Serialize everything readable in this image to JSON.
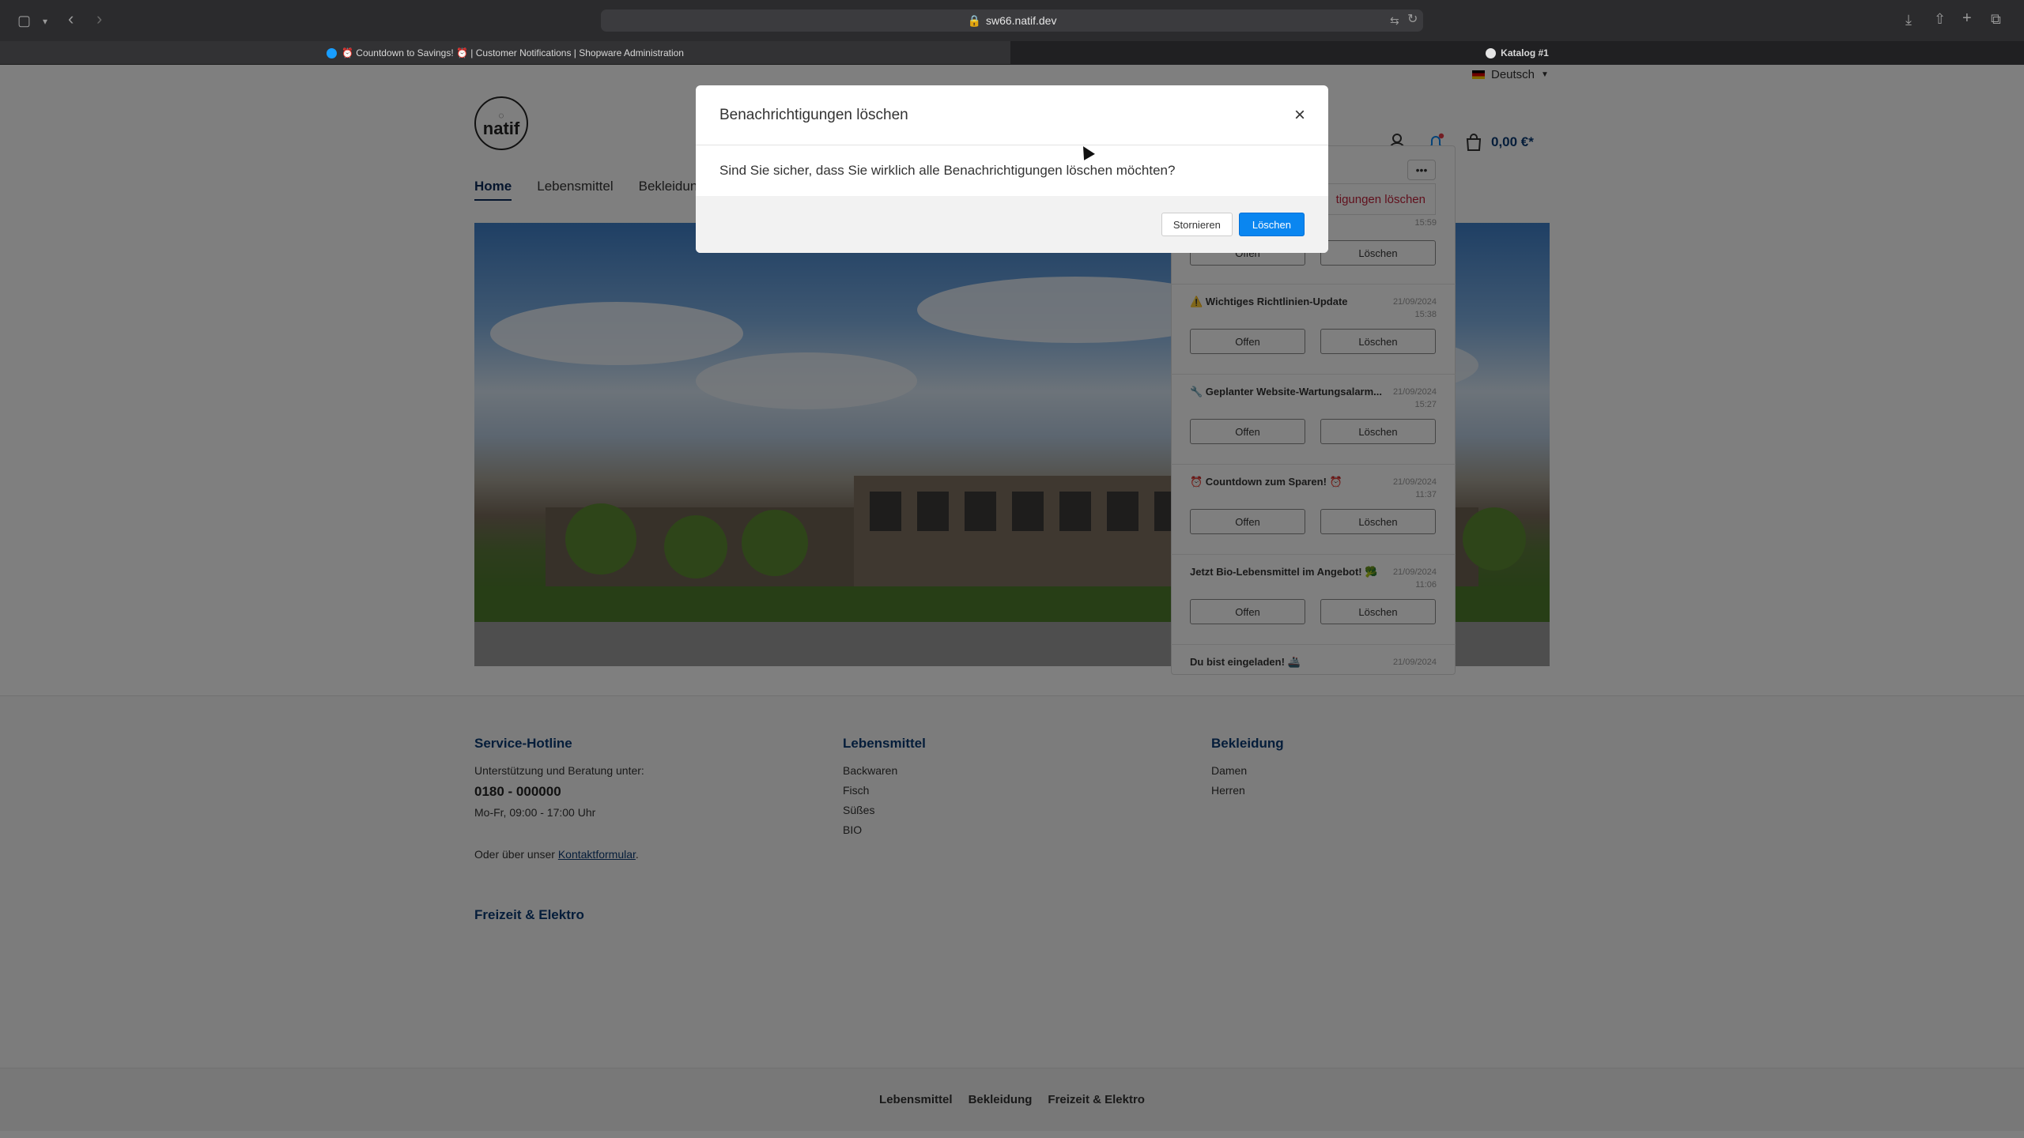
{
  "browser": {
    "url": "sw66.natif.dev",
    "tabs": [
      {
        "label": "⏰ Countdown to Savings! ⏰ | Customer Notifications | Shopware Administration"
      },
      {
        "label": "Katalog #1"
      }
    ]
  },
  "header": {
    "language": "Deutsch",
    "logo": "natif",
    "cart_total": "0,00 €*",
    "nav": [
      "Home",
      "Lebensmittel",
      "Bekleidun"
    ]
  },
  "notifications": {
    "delete_all_label": "tigungen löschen",
    "first_date": "15:59",
    "items": [
      {
        "title": "⚠️ Wichtiges Richtlinien-Update",
        "date": "21/09/2024",
        "time": "15:38",
        "open": "Offen",
        "delete": "Löschen"
      },
      {
        "title": "🔧 Geplanter Website-Wartungsalarm...",
        "date": "21/09/2024",
        "time": "15:27",
        "open": "Offen",
        "delete": "Löschen"
      },
      {
        "title": "⏰ Countdown zum Sparen! ⏰",
        "date": "21/09/2024",
        "time": "11:37",
        "open": "Offen",
        "delete": "Löschen"
      },
      {
        "title": "Jetzt Bio-Lebensmittel im Angebot! 🥦",
        "date": "21/09/2024",
        "time": "11:06",
        "open": "Offen",
        "delete": "Löschen"
      },
      {
        "title": "Du bist eingeladen! 🚢",
        "date": "21/09/2024",
        "time": ""
      }
    ],
    "first_open": "Offen",
    "first_delete": "Löschen"
  },
  "modal": {
    "title": "Benachrichtigungen löschen",
    "body": "Sind Sie sicher, dass Sie wirklich alle Benachrichtigungen löschen möchten?",
    "cancel": "Stornieren",
    "confirm": "Löschen"
  },
  "footer": {
    "hotline": {
      "title": "Service-Hotline",
      "intro": "Unterstützung und Beratung unter:",
      "phone": "0180 - 000000",
      "hours": "Mo-Fr, 09:00 - 17:00 Uhr",
      "contact_prefix": "Oder über unser ",
      "contact_link": "Kontaktformular",
      "contact_suffix": "."
    },
    "lebensmittel": {
      "title": "Lebensmittel",
      "items": [
        "Backwaren",
        "Fisch",
        "Süßes",
        "BIO"
      ]
    },
    "bekleidung": {
      "title": "Bekleidung",
      "items": [
        "Damen",
        "Herren"
      ]
    },
    "freizeit": {
      "title": "Freizeit & Elektro"
    },
    "bottom_nav": [
      "Lebensmittel",
      "Bekleidung",
      "Freizeit & Elektro"
    ]
  },
  "colors": {
    "accent": "#0a86f0",
    "brand": "#0b3b75",
    "danger": "#c0223b"
  }
}
